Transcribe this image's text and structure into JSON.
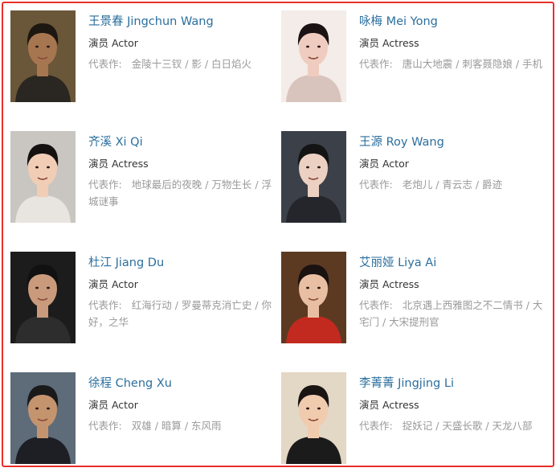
{
  "works_label": "代表作:",
  "people": [
    {
      "name": "王景春 Jingchun Wang",
      "role": "演员 Actor",
      "works": "金陵十三钗 / 影 / 白日焰火",
      "photo_colors": {
        "bg": "#6a5638",
        "hair": "#1d1712",
        "skin": "#a67650",
        "cloth": "#2a2621"
      }
    },
    {
      "name": "咏梅 Mei Yong",
      "role": "演员 Actress",
      "works": "唐山大地震 / 刺客聂隐娘 / 手机",
      "photo_colors": {
        "bg": "#f3ece8",
        "hair": "#1b1313",
        "skin": "#f0ccc0",
        "cloth": "#d9c3bd"
      }
    },
    {
      "name": "齐溪 Xi Qi",
      "role": "演员 Actress",
      "works": "地球最后的夜晚 / 万物生长 / 浮城谜事",
      "photo_colors": {
        "bg": "#c9c5c0",
        "hair": "#151110",
        "skin": "#f1cdb6",
        "cloth": "#e8e4df"
      }
    },
    {
      "name": "王源 Roy Wang",
      "role": "演员 Actor",
      "works": "老炮儿 / 青云志 / 爵迹",
      "photo_colors": {
        "bg": "#3c4048",
        "hair": "#141414",
        "skin": "#ecd0c2",
        "cloth": "#24262c"
      }
    },
    {
      "name": "杜江 Jiang Du",
      "role": "演员 Actor",
      "works": "红海行动 / 罗曼蒂克消亡史 / 你好，之华",
      "photo_colors": {
        "bg": "#1c1c1c",
        "hair": "#111111",
        "skin": "#c99a7c",
        "cloth": "#2d2d2d"
      }
    },
    {
      "name": "艾丽娅 Liya Ai",
      "role": "演员 Actress",
      "works": "北京遇上西雅图之不二情书 / 大宅门 / 大宋提刑官",
      "photo_colors": {
        "bg": "#5c3a22",
        "hair": "#1a1210",
        "skin": "#e9bfa4",
        "cloth": "#c22a1f"
      }
    },
    {
      "name": "徐程 Cheng Xu",
      "role": "演员 Actor",
      "works": "双雄 / 暗算 / 东风雨",
      "photo_colors": {
        "bg": "#5e6b78",
        "hair": "#1a1a1a",
        "skin": "#c4946f",
        "cloth": "#1e1f24"
      }
    },
    {
      "name": "李菁菁 Jingjing Li",
      "role": "演员 Actress",
      "works": "捉妖记 / 天盛长歌 / 天龙八部",
      "photo_colors": {
        "bg": "#e3d7c5",
        "hair": "#1a1412",
        "skin": "#f1cbae",
        "cloth": "#1b1b1b"
      }
    }
  ]
}
